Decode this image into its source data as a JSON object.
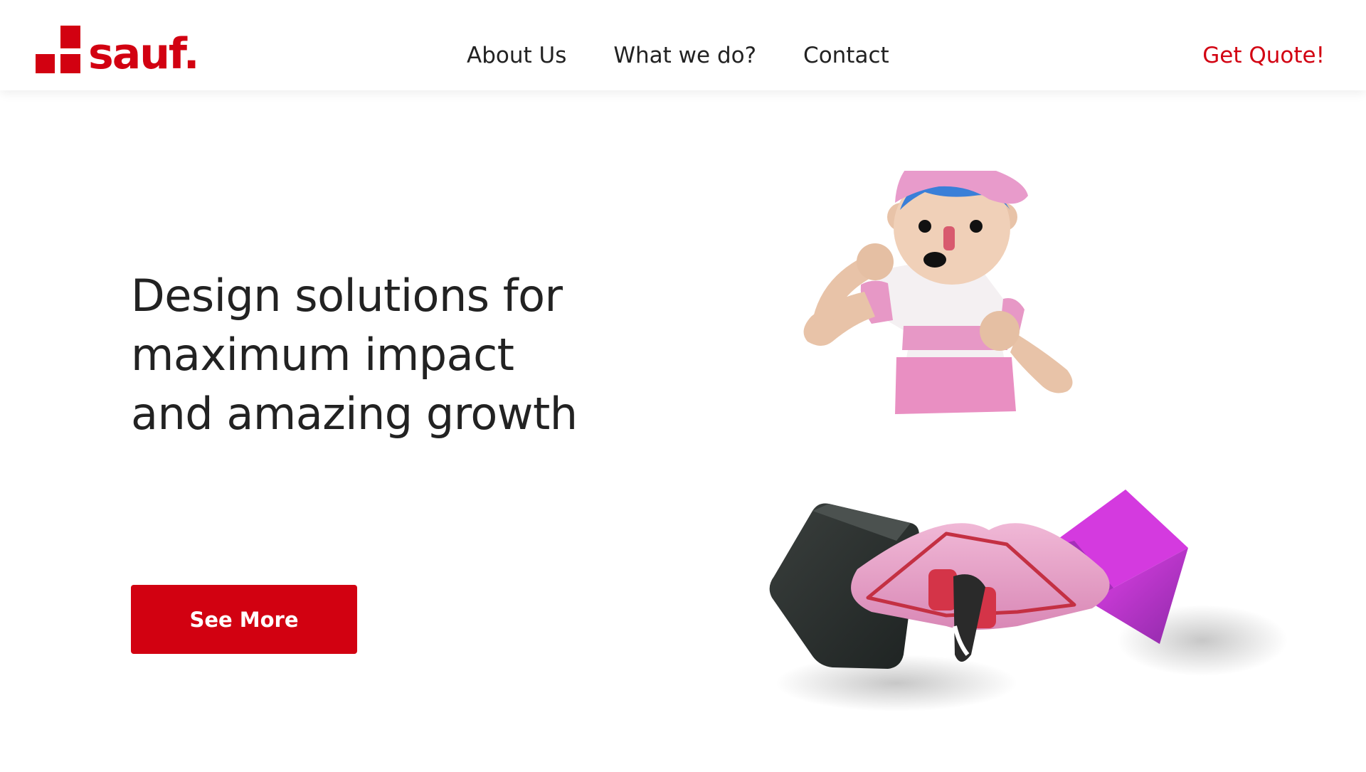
{
  "header": {
    "logo_text": "sauf.",
    "nav": [
      {
        "label": "About Us"
      },
      {
        "label": "What we do?"
      },
      {
        "label": "Contact"
      }
    ],
    "cta_label": "Get Quote!"
  },
  "hero": {
    "title_lines": [
      "Design solutions for",
      "maximum impact",
      "and amazing growth"
    ],
    "button_label": "See More"
  },
  "colors": {
    "brand": "#D20111",
    "text": "#222222",
    "background": "#FFFFFF"
  },
  "icons": {
    "logo_mark": "stacked-red-blocks-icon",
    "illustration": "3d-character-illustration"
  }
}
